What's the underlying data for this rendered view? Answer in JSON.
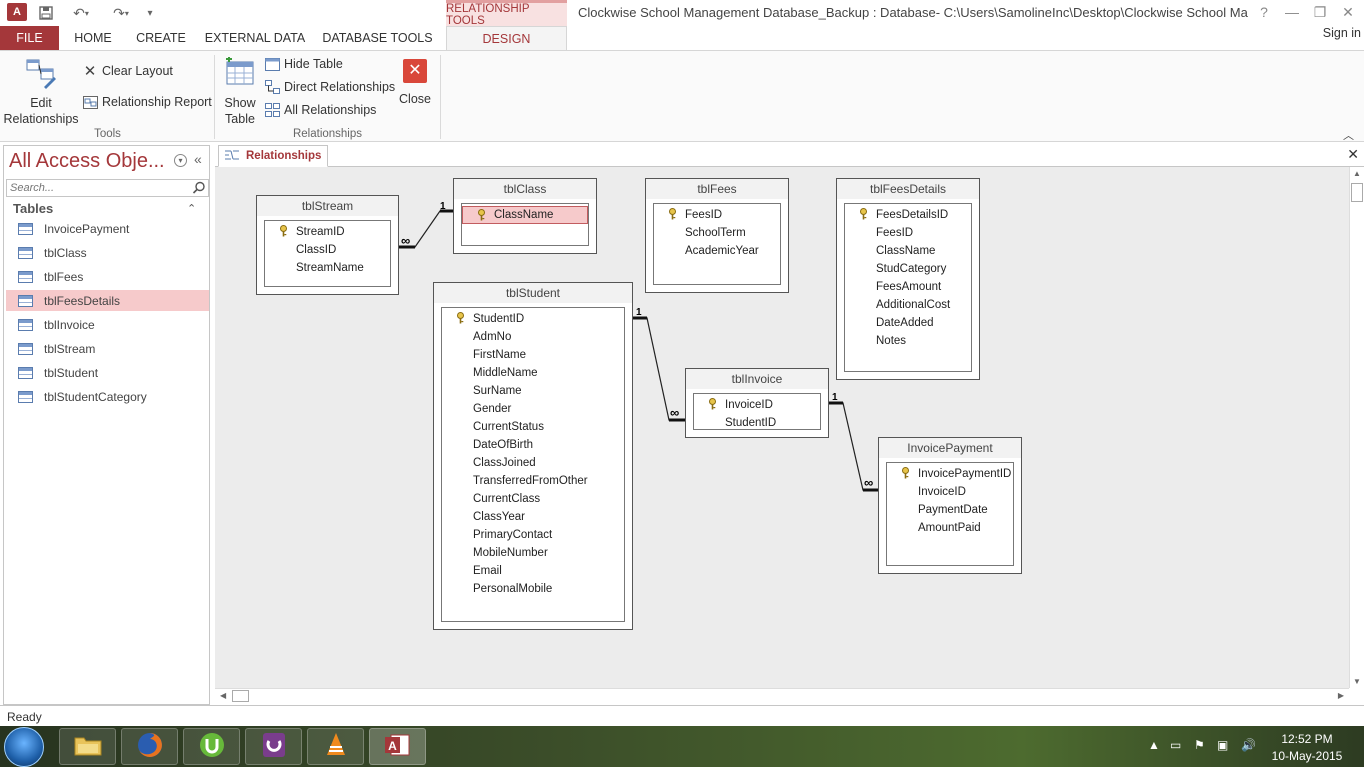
{
  "titlebar": {
    "app_icon_text": "A",
    "context_tab": "RELATIONSHIP TOOLS",
    "window_title": "Clockwise School Management Database_Backup : Database- C:\\Users\\SamolineInc\\Desktop\\Clockwise School Manageme...",
    "help": "?"
  },
  "ribbon_tabs": [
    "FILE",
    "HOME",
    "CREATE",
    "EXTERNAL DATA",
    "DATABASE TOOLS"
  ],
  "ribbon_active_tab": "DESIGN",
  "signin": "Sign in",
  "ribbon": {
    "edit_relationships": [
      "Edit",
      "Relationships"
    ],
    "clear_layout": "Clear Layout",
    "relationship_report": "Relationship Report",
    "tools_group": "Tools",
    "show_table": [
      "Show",
      "Table"
    ],
    "hide_table": "Hide Table",
    "direct_relationships": "Direct Relationships",
    "all_relationships": "All Relationships",
    "close": "Close",
    "relationships_group": "Relationships"
  },
  "nav": {
    "title": "All Access Obje...",
    "search_placeholder": "Search...",
    "group": "Tables",
    "items": [
      "InvoicePayment",
      "tblClass",
      "tblFees",
      "tblFeesDetails",
      "tblInvoice",
      "tblStream",
      "tblStudent",
      "tblStudentCategory"
    ],
    "selected": "tblFeesDetails"
  },
  "doc_tab": "Relationships",
  "tables": {
    "tblStream": {
      "title": "tblStream",
      "fields": [
        "StreamID",
        "ClassID",
        "StreamName"
      ],
      "key": "StreamID"
    },
    "tblClass": {
      "title": "tblClass",
      "fields": [
        "ClassName"
      ],
      "key": "ClassName",
      "selected": "ClassName"
    },
    "tblFees": {
      "title": "tblFees",
      "fields": [
        "FeesID",
        "SchoolTerm",
        "AcademicYear"
      ],
      "key": "FeesID"
    },
    "tblFeesDetails": {
      "title": "tblFeesDetails",
      "fields": [
        "FeesDetailsID",
        "FeesID",
        "ClassName",
        "StudCategory",
        "FeesAmount",
        "AdditionalCost",
        "DateAdded",
        "Notes"
      ],
      "key": "FeesDetailsID"
    },
    "tblStudent": {
      "title": "tblStudent",
      "fields": [
        "StudentID",
        "AdmNo",
        "FirstName",
        "MiddleName",
        "SurName",
        "Gender",
        "CurrentStatus",
        "DateOfBirth",
        "ClassJoined",
        "TransferredFromOther",
        "CurrentClass",
        "ClassYear",
        "PrimaryContact",
        "MobileNumber",
        "Email",
        "PersonalMobile"
      ],
      "key": "StudentID"
    },
    "tblInvoice": {
      "title": "tblInvoice",
      "fields": [
        "InvoiceID",
        "StudentID"
      ],
      "key": "InvoiceID"
    },
    "InvoicePayment": {
      "title": "InvoicePayment",
      "fields": [
        "InvoicePaymentID",
        "InvoiceID",
        "PaymentDate",
        "AmountPaid"
      ],
      "key": "InvoicePaymentID"
    }
  },
  "cardinality": {
    "one": "1",
    "many": "∞"
  },
  "status": "Ready",
  "clock": {
    "time": "12:52 PM",
    "date": "10-May-2015"
  },
  "colors": {
    "accent": "#a4373a",
    "selection": "#f6cacb"
  }
}
